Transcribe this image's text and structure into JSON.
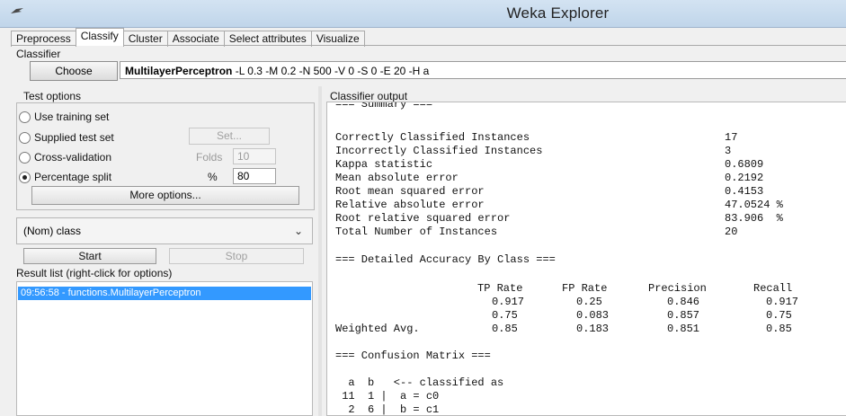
{
  "window": {
    "title": "Weka Explorer",
    "icon": "weka-bird-icon"
  },
  "tabs": [
    "Preprocess",
    "Classify",
    "Cluster",
    "Associate",
    "Select attributes",
    "Visualize"
  ],
  "classifier": {
    "section_label": "Classifier",
    "choose_label": "Choose",
    "name": "MultilayerPerceptron",
    "options": "-L 0.3 -M 0.2 -N 500 -V 0 -S 0 -E 20 -H a"
  },
  "test_options": {
    "label": "Test options",
    "use_training_set": "Use training set",
    "supplied_test_set": "Supplied test set",
    "set_button": "Set...",
    "cross_validation": "Cross-validation",
    "folds_label": "Folds",
    "folds_value": "10",
    "percentage_split": "Percentage split",
    "percent_label": "%",
    "percent_value": "80",
    "more_options": "More options..."
  },
  "class_select": {
    "value": "(Nom) class"
  },
  "run": {
    "start": "Start",
    "stop": "Stop"
  },
  "result_list": {
    "label": "Result list (right-click for options)",
    "items": [
      "09:56:58 - functions.MultilayerPerceptron"
    ]
  },
  "output": {
    "label": "Classifier output",
    "header_summary": "=== Summary ===",
    "summary": [
      {
        "name": "Correctly Classified Instances",
        "value": "17"
      },
      {
        "name": "Incorrectly Classified Instances",
        "value": "3"
      },
      {
        "name": "Kappa statistic",
        "value": "0.6809"
      },
      {
        "name": "Mean absolute error",
        "value": "0.2192"
      },
      {
        "name": "Root mean squared error",
        "value": "0.4153"
      },
      {
        "name": "Relative absolute error",
        "value": "47.0524 %"
      },
      {
        "name": "Root relative squared error",
        "value": "83.906  %"
      },
      {
        "name": "Total Number of Instances",
        "value": "20"
      }
    ],
    "header_accuracy": "=== Detailed Accuracy By Class ===",
    "accuracy_columns": [
      "TP Rate",
      "FP Rate",
      "Precision",
      "Recall"
    ],
    "accuracy_rows": [
      {
        "label": "",
        "values": [
          "0.917",
          "0.25",
          "0.846",
          "0.917"
        ]
      },
      {
        "label": "",
        "values": [
          "0.75",
          "0.083",
          "0.857",
          "0.75"
        ]
      },
      {
        "label": "Weighted Avg.",
        "values": [
          "0.85",
          "0.183",
          "0.851",
          "0.85"
        ]
      }
    ],
    "header_confusion": "=== Confusion Matrix ===",
    "confusion_header": "  a  b   <-- classified as",
    "confusion_rows": [
      " 11  1 |  a = c0",
      "  2  6 |  b = c1"
    ]
  }
}
